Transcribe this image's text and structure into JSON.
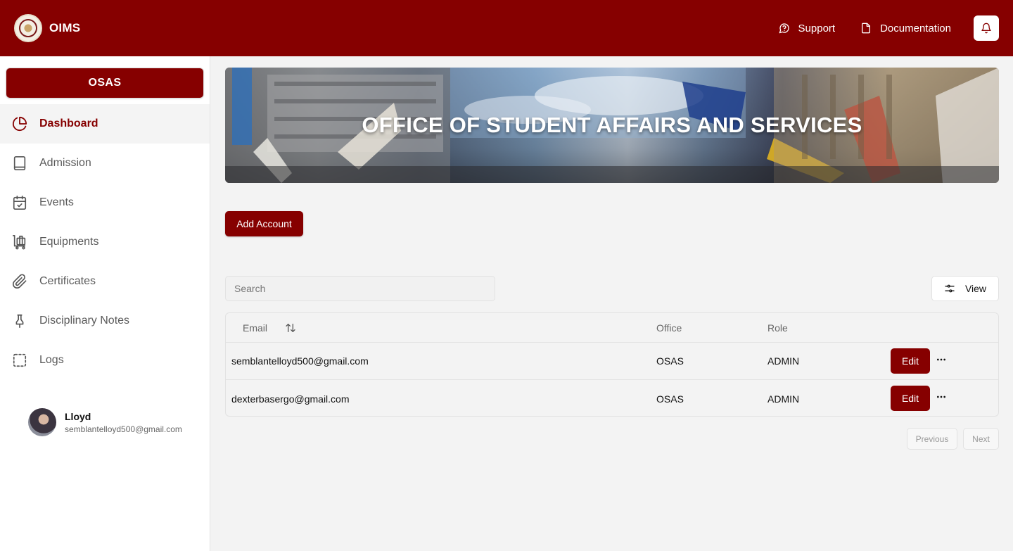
{
  "header": {
    "app_name": "OIMS",
    "links": [
      {
        "label": "Support",
        "icon": "message-circle-question-icon"
      },
      {
        "label": "Documentation",
        "icon": "file-icon"
      }
    ],
    "notification_icon": "bell-icon"
  },
  "sidebar": {
    "org": "OSAS",
    "items": [
      {
        "label": "Dashboard",
        "icon": "pie-chart-icon",
        "active": true
      },
      {
        "label": "Admission",
        "icon": "book-icon"
      },
      {
        "label": "Events",
        "icon": "calendar-check-icon"
      },
      {
        "label": "Equipments",
        "icon": "luggage-cart-icon"
      },
      {
        "label": "Certificates",
        "icon": "paperclip-icon"
      },
      {
        "label": "Disciplinary Notes",
        "icon": "pin-icon"
      },
      {
        "label": "Logs",
        "icon": "dashed-square-icon"
      }
    ],
    "user": {
      "name": "Lloyd",
      "email": "semblantelloyd500@gmail.com"
    }
  },
  "main": {
    "banner_title": "OFFICE OF STUDENT AFFAIRS AND SERVICES",
    "add_account_label": "Add Account",
    "search_placeholder": "Search",
    "view_label": "View",
    "table": {
      "columns": [
        "Email",
        "Office",
        "Role"
      ],
      "rows": [
        {
          "email": "semblantelloyd500@gmail.com",
          "office": "OSAS",
          "role": "ADMIN",
          "action": "Edit"
        },
        {
          "email": "dexterbasergo@gmail.com",
          "office": "OSAS",
          "role": "ADMIN",
          "action": "Edit"
        }
      ]
    },
    "pagination": {
      "previous": "Previous",
      "next": "Next"
    }
  },
  "colors": {
    "brand": "#860000",
    "background": "#f3f3f3",
    "sidebar": "#ffffff"
  }
}
